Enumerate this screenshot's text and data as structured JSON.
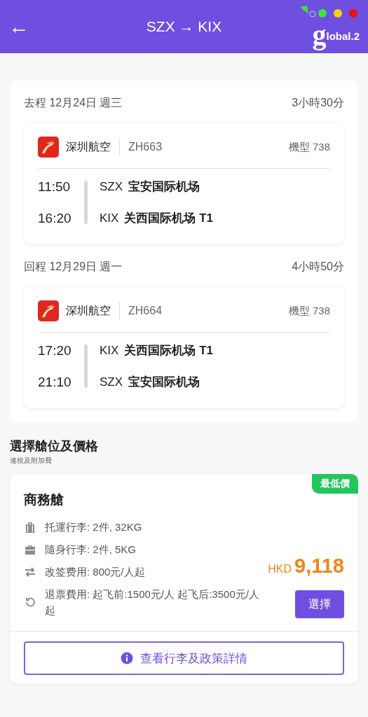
{
  "header": {
    "back_icon": "←",
    "title": "SZX → KIX",
    "logo": {
      "initial": "g",
      "rest": "lobal.2"
    }
  },
  "legs": [
    {
      "label": "去程 12月24日 週三",
      "duration": "3小時30分",
      "airline": "深圳航空",
      "flight_no": "ZH663",
      "aircraft": "機型 738",
      "stops": [
        {
          "time": "11:50",
          "code": "SZX",
          "airport": "宝安国际机场"
        },
        {
          "time": "16:20",
          "code": "KIX",
          "airport": "关西国际机场 T1"
        }
      ]
    },
    {
      "label": "回程 12月29日 週一",
      "duration": "4小時50分",
      "airline": "深圳航空",
      "flight_no": "ZH664",
      "aircraft": "機型 738",
      "stops": [
        {
          "time": "17:20",
          "code": "KIX",
          "airport": "关西国际机场 T1"
        },
        {
          "time": "21:10",
          "code": "SZX",
          "airport": "宝安国际机场"
        }
      ]
    }
  ],
  "fare_section": {
    "title": "選擇艙位及價格",
    "subtitle": "連稅及附加費"
  },
  "fare": {
    "badge": "最低價",
    "cabin": "商務艙",
    "policies": [
      {
        "kind": "checked-bag",
        "text": "托運行李: 2件, 32KG"
      },
      {
        "kind": "carry-on",
        "text": "隨身行李: 2件, 5KG"
      },
      {
        "kind": "change",
        "text": "改签费用: 800元/人起"
      },
      {
        "kind": "refund",
        "text": "退票費用: 起飞前:1500元/人 起飞后:3500元/人起"
      }
    ],
    "currency": "HKD",
    "price": "9,118",
    "select_button": "選擇",
    "details_button": "查看行李及政策詳情"
  }
}
